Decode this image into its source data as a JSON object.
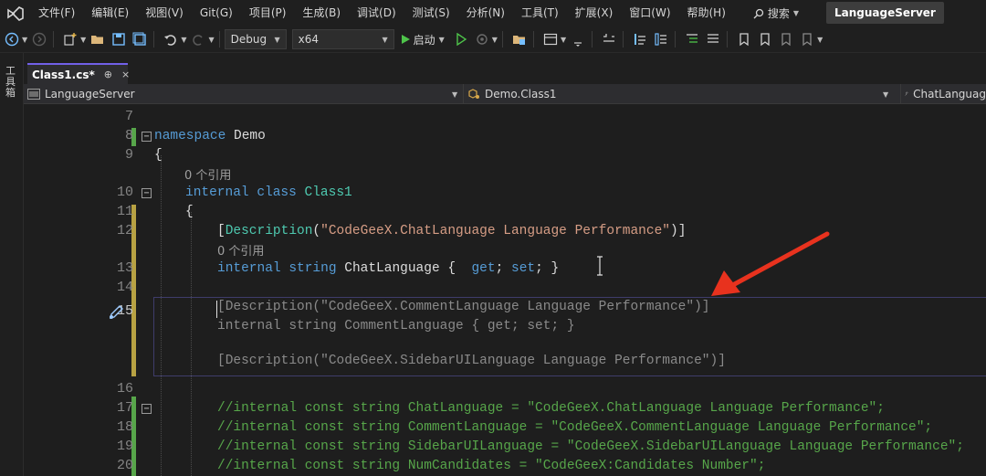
{
  "menubar": {
    "items": [
      "文件(F)",
      "编辑(E)",
      "视图(V)",
      "Git(G)",
      "项目(P)",
      "生成(B)",
      "调试(D)",
      "测试(S)",
      "分析(N)",
      "工具(T)",
      "扩展(X)",
      "窗口(W)",
      "帮助(H)"
    ],
    "search_label": "搜索",
    "solution_title": "LanguageServer"
  },
  "toolbar": {
    "configuration": "Debug",
    "platform": "x64",
    "start_label": "启动"
  },
  "side_strip": {
    "label": "工具箱"
  },
  "tabs": [
    {
      "label": "Class1.cs*",
      "pin": "⊕",
      "close": "×"
    }
  ],
  "navbar": {
    "project": "LanguageServer",
    "class": "Demo.Class1",
    "member": "ChatLanguag"
  },
  "editor": {
    "line_numbers": [
      "7",
      "8",
      "9",
      "10",
      "11",
      "12",
      "13",
      "14",
      "15",
      "16",
      "17",
      "18",
      "19",
      "20"
    ],
    "codelens": "0 个引用",
    "line8": {
      "kw": "namespace",
      "rest": " Demo"
    },
    "line9": "{",
    "line10": {
      "kw": "internal class",
      "type": " Class1"
    },
    "line11": "{",
    "line12": {
      "open": "[",
      "attr": "Description",
      "paren": "(",
      "str": "\"CodeGeeX.ChatLanguage Language Performance\"",
      "close": ")]"
    },
    "line13": {
      "kw1": "internal",
      "kw2": " string",
      "name": " ChatLanguage",
      "brace_open": " {  ",
      "get": "get",
      "semi1": "; ",
      "set": "set",
      "semi2": "; }"
    },
    "ghost1": "[Description(\"CodeGeeX.CommentLanguage Language Performance\")]",
    "ghost2": "internal string CommentLanguage { get; set; }",
    "ghost3": "[Description(\"CodeGeeX.SidebarUILanguage Language Performance\")]",
    "comments": [
      "//internal const string ChatLanguage = \"CodeGeeX.ChatLanguage Language Performance\";",
      "//internal const string CommentLanguage = \"CodeGeeX.CommentLanguage Language Performance\";",
      "//internal const string SidebarUILanguage = \"CodeGeeX.SidebarUILanguage Language Performance\";",
      "//internal const string NumCandidates = \"CodeGeeX:Candidates Number\";"
    ]
  },
  "colors": {
    "accent_tab": "#7160e8",
    "arrow": "#e8321e",
    "change_saved": "#57a64a",
    "change_unsaved": "#b8a243"
  }
}
